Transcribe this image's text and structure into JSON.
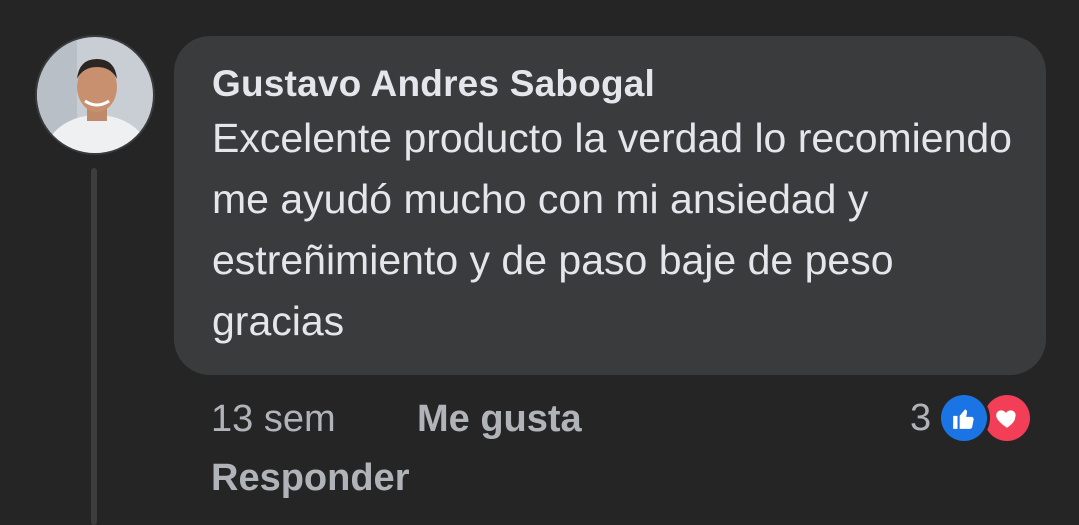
{
  "comment": {
    "author": "Gustavo Andres Sabogal",
    "text": "Excelente producto la verdad lo recomiendo me ayudó mucho con mi ansiedad y estreñimiento y de paso baje de peso gracias",
    "avatar_icon": "user-avatar-photo",
    "time": "13 sem",
    "like_label": "Me gusta",
    "reply_label": "Responder",
    "reaction_count": "3",
    "reactions": [
      "like-icon",
      "love-icon"
    ]
  },
  "colors": {
    "background": "#252526",
    "bubble": "#3a3b3c",
    "primary_text": "#e4e6eb",
    "secondary_text": "#b0b3b8",
    "like_blue": "#1b74e4",
    "love_red": "#f33e58"
  }
}
